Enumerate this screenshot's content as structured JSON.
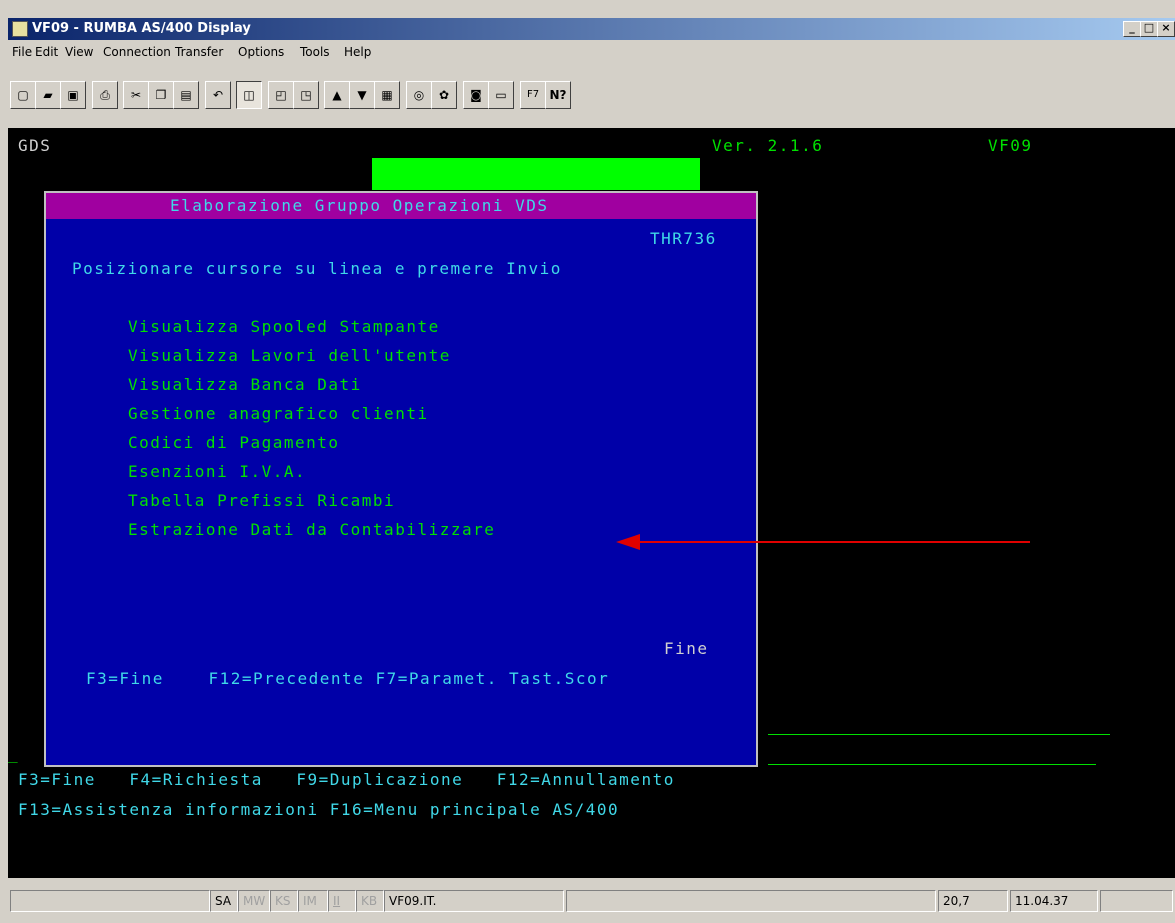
{
  "window": {
    "title": "VF09 - RUMBA AS/400 Display",
    "minimize": "_",
    "maximize": "□",
    "close": "×"
  },
  "menu": [
    "File",
    "Edit",
    "View",
    "Connection",
    "Transfer",
    "Options",
    "Tools",
    "Help"
  ],
  "toolbar_icons": [
    "new-icon",
    "open-icon",
    "save-icon",
    "print-icon",
    "cut-icon",
    "copy-icon",
    "paste-icon",
    "undo-icon",
    "session-icon",
    "window1-icon",
    "window2-icon",
    "send-icon",
    "receive-icon",
    "transfer-icon",
    "macro-icon",
    "palette-icon",
    "camera-icon",
    "printer-settings-icon",
    "f7-key-icon",
    "help-icon"
  ],
  "toolbar_f7": "F7",
  "toolbar_help": "N?",
  "screen": {
    "system": "GDS",
    "version": "Ver. 2.1.6",
    "session_name": "VF09",
    "footer_line1": "F3=Fine   F4=Richiesta   F9=Duplicazione   F12=Annullamento",
    "footer_line2": "F13=Assistenza informazioni F16=Menu principale AS/400",
    "left_marker": "_"
  },
  "popup": {
    "title": "Elaborazione Gruppo Operazioni VDS",
    "program": "THR736",
    "instruction": "Posizionare cursore su linea e premere Invio",
    "items": [
      "Visualizza Spooled Stampante",
      "Visualizza Lavori dell'utente",
      "Visualizza Banca Dati",
      "Gestione anagrafico clienti",
      "Codici di Pagamento",
      "Esenzioni I.V.A.",
      "Tabella Prefissi Ricambi",
      "Estrazione Dati da Contabilizzare"
    ],
    "end_label": "Fine",
    "fkeys": "F3=Fine    F12=Precedente F7=Paramet. Tast.Scor"
  },
  "status": {
    "sa": "SA",
    "mw": "MW",
    "ks": "KS",
    "im": "IM",
    "ii": "II",
    "kb": "KB",
    "session": "VF09.IT.",
    "cursor": "20,7",
    "time": "11.04.37"
  },
  "colors": {
    "terminal_bg": "#000000",
    "popup_bg": "#0000a8",
    "popup_title_bg": "#a000a0",
    "green": "#00e000",
    "arrow": "#e00000"
  }
}
